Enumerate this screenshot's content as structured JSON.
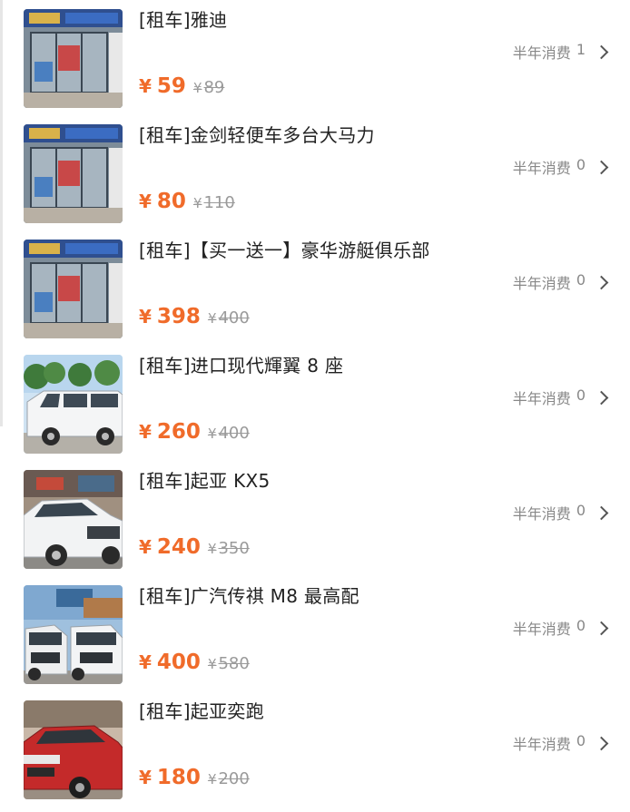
{
  "items": [
    {
      "title": "[租车]雅迪",
      "consume_label": "半年消费",
      "consume_count": "1",
      "currency": "¥",
      "price": "59",
      "original_price": "89",
      "thumb": "store"
    },
    {
      "title": "[租车]金剑轻便车多台大马力",
      "consume_label": "半年消费",
      "consume_count": "0",
      "currency": "¥",
      "price": "80",
      "original_price": "110",
      "thumb": "store"
    },
    {
      "title": "[租车]【买一送一】豪华游艇俱乐部",
      "consume_label": "半年消费",
      "consume_count": "0",
      "currency": "¥",
      "price": "398",
      "original_price": "400",
      "thumb": "store"
    },
    {
      "title": "[租车]进口现代輝翼 8 座",
      "consume_label": "半年消费",
      "consume_count": "0",
      "currency": "¥",
      "price": "260",
      "original_price": "400",
      "thumb": "white-van"
    },
    {
      "title": "[租车]起亚 KX5",
      "consume_label": "半年消费",
      "consume_count": "0",
      "currency": "¥",
      "price": "240",
      "original_price": "350",
      "thumb": "white-suv"
    },
    {
      "title": "[租车]广汽传祺 M8 最高配",
      "consume_label": "半年消费",
      "consume_count": "0",
      "currency": "¥",
      "price": "400",
      "original_price": "580",
      "thumb": "mpv-pair"
    },
    {
      "title": "[租车]起亚奕跑",
      "consume_label": "半年消费",
      "consume_count": "0",
      "currency": "¥",
      "price": "180",
      "original_price": "200",
      "thumb": "red-car"
    }
  ],
  "colors": {
    "price": "#f06b2a",
    "muted": "#888888",
    "title": "#222222"
  }
}
